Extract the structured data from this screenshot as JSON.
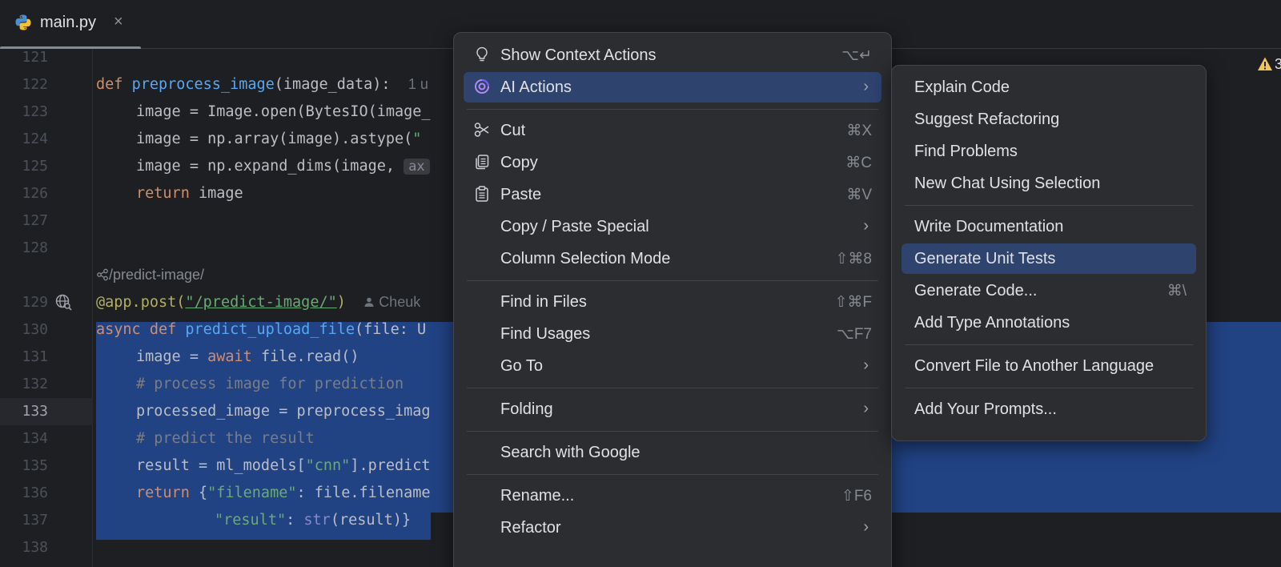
{
  "tab": {
    "title": "main.py",
    "close": "×"
  },
  "editor": {
    "lines": [
      "121",
      "122",
      "123",
      "124",
      "125",
      "126",
      "127",
      "128",
      "129",
      "130",
      "131",
      "132",
      "133",
      "134",
      "135",
      "136",
      "137",
      "138"
    ],
    "usage_hint": "1 u",
    "axis_hint": "ax",
    "route_lens": "/predict-image/",
    "author_hint": "Cheuk",
    "warning_count": "3"
  },
  "code": {
    "l122": {
      "kw": "def",
      "fn": "preprocess_image",
      "rest": "(image_data):"
    },
    "l123": "image = Image.open(BytesIO(image_",
    "l124": {
      "a": "image = np.array(image).astype(",
      "b": "\""
    },
    "l125": "image = np.expand_dims(image, ",
    "l126": {
      "kw": "return",
      "rest": " image"
    },
    "l129": {
      "dec": "@app.post(",
      "str": "\"/predict-image/\"",
      "rest": ")"
    },
    "l130": {
      "kw": "async def",
      "fn": "predict_upload_file",
      "rest": "(file: U"
    },
    "l131": {
      "a": "image = ",
      "kw": "await",
      "b": " file.read()"
    },
    "l132": "# process image for prediction",
    "l133": "processed_image = preprocess_imag",
    "l134": "# predict the result",
    "l135": {
      "a": "result = ml_models[",
      "str": "\"cnn\"",
      "b": "].predict"
    },
    "l136": {
      "kw": "return",
      "a": " {",
      "str": "\"filename\"",
      "b": ": file.filename"
    },
    "l137": {
      "str": "\"result\"",
      "a": ": ",
      "bi": "str",
      "b": "(result)}"
    }
  },
  "context_menu": {
    "items": [
      {
        "label": "Show Context Actions",
        "shortcut": "⌥↵"
      },
      {
        "label": "AI Actions",
        "arrow": "›"
      },
      {
        "label": "Cut",
        "shortcut": "⌘X"
      },
      {
        "label": "Copy",
        "shortcut": "⌘C"
      },
      {
        "label": "Paste",
        "shortcut": "⌘V"
      },
      {
        "label": "Copy / Paste Special",
        "arrow": "›"
      },
      {
        "label": "Column Selection Mode",
        "shortcut": "⇧⌘8"
      },
      {
        "label": "Find in Files",
        "shortcut": "⇧⌘F"
      },
      {
        "label": "Find Usages",
        "shortcut": "⌥F7"
      },
      {
        "label": "Go To",
        "arrow": "›"
      },
      {
        "label": "Folding",
        "arrow": "›"
      },
      {
        "label": "Search with Google"
      },
      {
        "label": "Rename...",
        "shortcut": "⇧F6"
      },
      {
        "label": "Refactor",
        "arrow": "›"
      }
    ]
  },
  "ai_submenu": {
    "items": [
      {
        "label": "Explain Code"
      },
      {
        "label": "Suggest Refactoring"
      },
      {
        "label": "Find Problems"
      },
      {
        "label": "New Chat Using Selection"
      },
      {
        "label": "Write Documentation"
      },
      {
        "label": "Generate Unit Tests"
      },
      {
        "label": "Generate Code...",
        "shortcut": "⌘\\"
      },
      {
        "label": "Add Type Annotations"
      },
      {
        "label": "Convert File to Another Language"
      },
      {
        "label": "Add Your Prompts..."
      }
    ]
  },
  "colors": {
    "accent": "#2e436e",
    "selection": "#214283",
    "background": "#1e1f22",
    "menu": "#2b2d30"
  }
}
